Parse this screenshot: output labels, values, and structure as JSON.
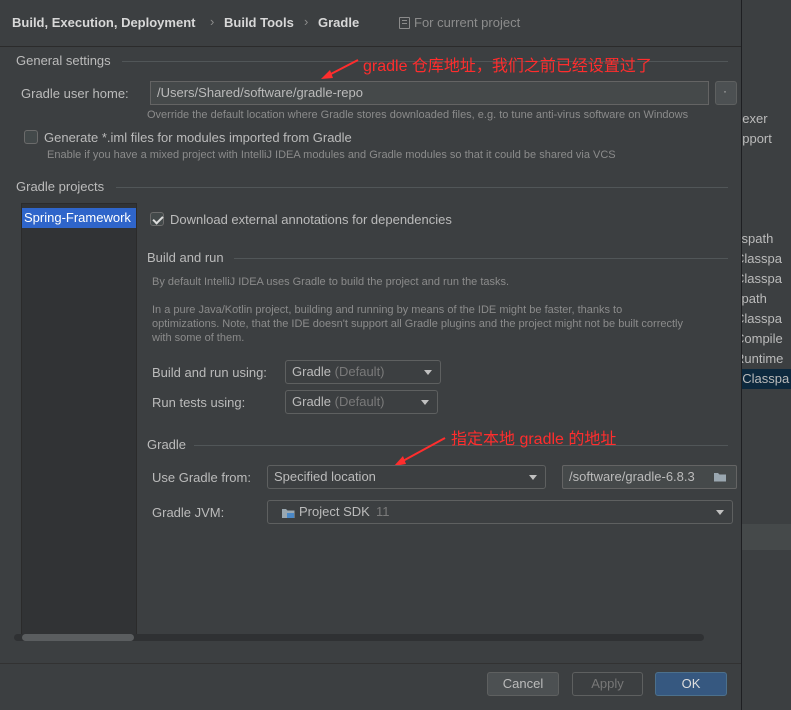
{
  "breadcrumb": {
    "items": [
      "Build, Execution, Deployment",
      "Build Tools",
      "Gradle"
    ],
    "scope": "For current project"
  },
  "general": {
    "title": "General settings",
    "user_home_label": "Gradle user home:",
    "user_home_value": "/Users/Shared/software/gradle-repo",
    "user_home_hint": "Override the default location where Gradle stores downloaded files, e.g. to tune anti-virus software on Windows",
    "generate_iml_label": "Generate *.iml files for modules imported from Gradle",
    "generate_iml_checked": false,
    "generate_iml_hint": "Enable if you have a mixed project with IntelliJ IDEA modules and Gradle modules so that it could be shared via VCS"
  },
  "projects": {
    "title": "Gradle projects",
    "list": [
      "Spring-Framework"
    ],
    "download_annotations_label": "Download external annotations for dependencies",
    "download_annotations_checked": true
  },
  "build_and_run": {
    "title": "Build and run",
    "desc1": "By default IntelliJ IDEA uses Gradle to build the project and run the tasks.",
    "desc2_line1": "In a pure Java/Kotlin project, building and running by means of the IDE might be faster, thanks to",
    "desc2_line2": "optimizations. Note, that the IDE doesn't support all Gradle plugins and the project might not be built correctly",
    "desc2_line3": "with some of them.",
    "build_using_label": "Build and run using:",
    "build_using_value": "Gradle",
    "build_using_suffix": "(Default)",
    "tests_using_label": "Run tests using:",
    "tests_using_value": "Gradle",
    "tests_using_suffix": "(Default)"
  },
  "gradle": {
    "title": "Gradle",
    "use_from_label": "Use Gradle from:",
    "use_from_value": "Specified location",
    "location_value": "/software/gradle-6.8.3",
    "jvm_label": "Gradle JVM:",
    "jvm_value": "Project SDK",
    "jvm_version": "11"
  },
  "annotations": {
    "top": "gradle 仓库地址，我们之前已经设置过了",
    "middle": "指定本地 gradle 的地址"
  },
  "footer": {
    "cancel": "Cancel",
    "apply": "Apply",
    "ok": "OK"
  },
  "background_panel": {
    "items": [
      "dexer",
      "upport",
      "sspath",
      "Classpa",
      "Classpa",
      "spath",
      "Classpa",
      "Compile",
      "Runtime",
      "eClasspa",
      "n",
      "t",
      "g"
    ]
  },
  "colors": {
    "annotation": "#ff2d2d",
    "selection": "#2f65ca",
    "ok_button": "#365880"
  }
}
